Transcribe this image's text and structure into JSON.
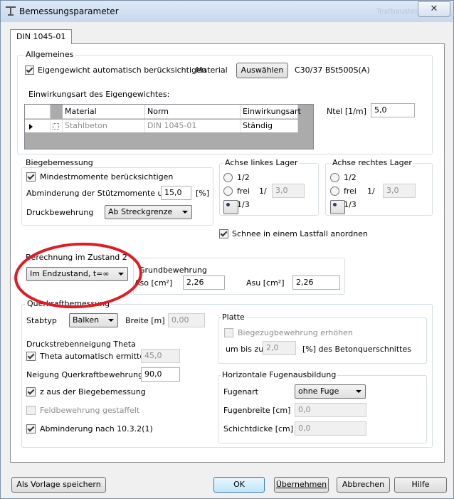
{
  "window": {
    "title": "Bemessungsparameter",
    "ghost_text": "Textbaustein",
    "close_label": "✕"
  },
  "tab": {
    "label": "DIN 1045-01"
  },
  "allgemeines": {
    "group_label": "Allgemeines",
    "eigengewicht_label": "Eigengewicht automatisch berücksichtigen",
    "material_label": "Material",
    "select_button": "Auswählen",
    "material_value": "C30/37 BSt500S(A)",
    "einwirkungsart_label": "Einwirkungsart des Eigengewichtes:",
    "ntel_label": "Ntel [1/m]",
    "ntel_value": "5,0",
    "table": {
      "columns": [
        "Material",
        "Norm",
        "Einwirkungsart"
      ],
      "rows": [
        {
          "material": "Stahlbeton",
          "norm": "DIN 1045-01",
          "einwirkungsart": "Ständig"
        }
      ]
    }
  },
  "biegebemessung": {
    "group_label": "Biegebemessung",
    "mindestmomente_label": "Mindestmomente berücksichtigen",
    "abminderung_label": "Abminderung der Stützmomente um :",
    "abminderung_value": "15,0",
    "abminderung_unit": "[%]",
    "druckbewehrung_label": "Druckbewehrung",
    "druckbewehrung_value": "Ab Streckgrenze"
  },
  "achse_links": {
    "group_label": "Achse linkes Lager",
    "opt1": "1/2",
    "opt2": "frei",
    "frei_unit": "1/",
    "frei_value": "3,0",
    "opt3": "1/3"
  },
  "achse_rechts": {
    "group_label": "Achse rechtes Lager",
    "opt1": "1/2",
    "opt2": "frei",
    "frei_unit": "1/",
    "frei_value": "3,0",
    "opt3": "1/3"
  },
  "schnee": {
    "label": "Schnee in einem Lastfall anordnen"
  },
  "zustand2": {
    "group_label": "Berechnung im Zustand 2",
    "value": "Im Endzustand, t=∞"
  },
  "grundbewehrung": {
    "group_label": "Grundbewehrung",
    "aso_label": "Aso [cm²]",
    "aso_value": "2,26",
    "asu_label": "Asu [cm²]",
    "asu_value": "2,26"
  },
  "querkraft": {
    "group_label": "Querkraftbemessung",
    "stabtyp_label": "Stabtyp",
    "stabtyp_value": "Balken",
    "breite_label": "Breite [m]",
    "breite_value": "0,00",
    "theta_section": "Druckstrebenneigung Theta",
    "theta_auto_label": "Theta automatisch ermitteln",
    "theta_value": "45,0",
    "neigung_label": "Neigung Querkraftbewehrung [°]",
    "neigung_value": "90,0",
    "z_label": "z aus der Biegebemessung",
    "feld_label": "Feldbewehrung gestaffelt",
    "abminderung_label": "Abminderung nach 10.3.2(1)"
  },
  "platte": {
    "group_label": "Platte",
    "biegezug_label": "Biegezugbewehrung erhöhen",
    "um_bis_label": "um bis zu",
    "um_bis_value": "2,0",
    "unit_label": "[%] des Betonquerschnittes"
  },
  "fugen": {
    "group_label": "Horizontale Fugenausbildung",
    "fugenart_label": "Fugenart",
    "fugenart_value": "ohne Fuge",
    "fugenbreite_label": "Fugenbreite [cm]",
    "fugenbreite_value": "0,0",
    "schicht_label": "Schichtdicke [cm]",
    "schicht_value": "0,0"
  },
  "footer": {
    "save_template": "Als Vorlage speichern",
    "ok": "OK",
    "apply": "Übernehmen",
    "cancel": "Abbrechen",
    "help": "Hilfe"
  },
  "colors": {
    "annotation_circle": "#e01b24",
    "titlebar": "#c6d8ee"
  }
}
